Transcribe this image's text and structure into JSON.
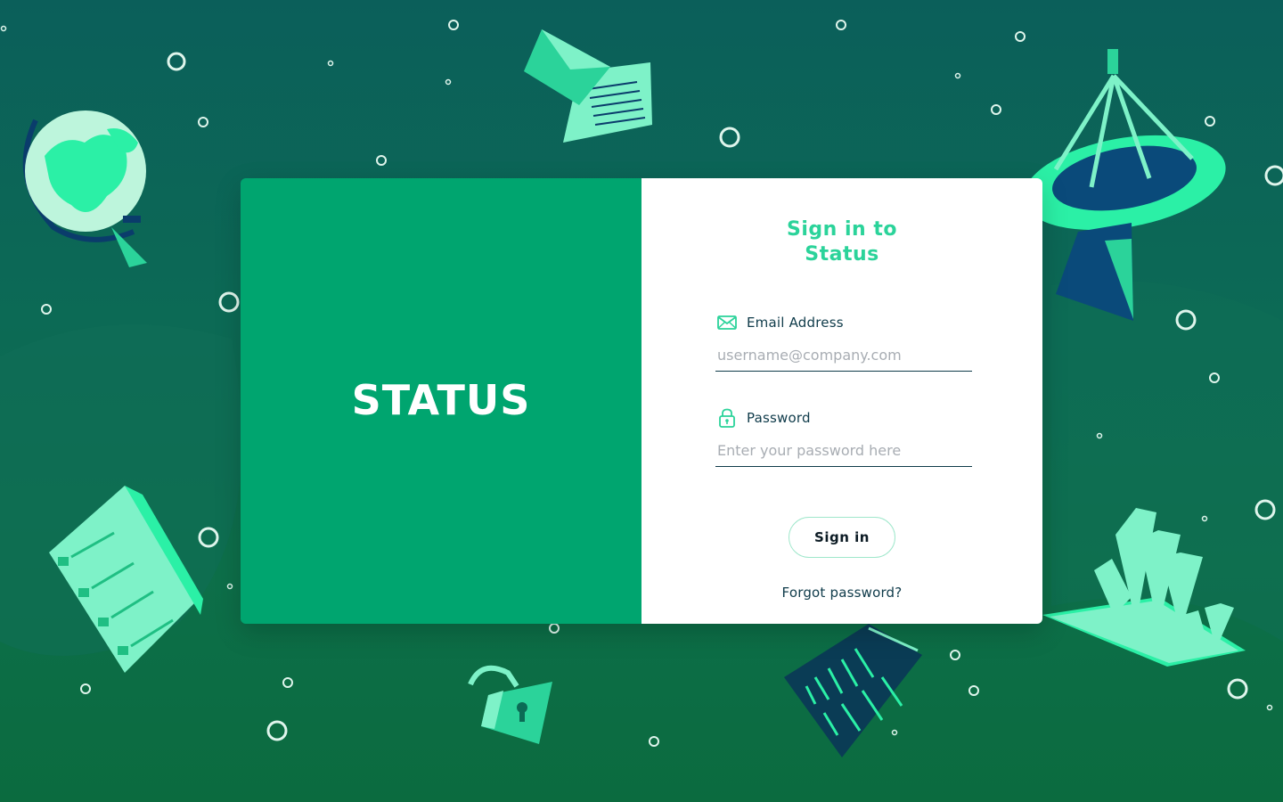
{
  "brand": {
    "logo_text": "STATUS",
    "panel_color": "#00a56f"
  },
  "form": {
    "title_line1": "Sign in to",
    "title_line2": "Status",
    "title_color": "#2bd39a",
    "email": {
      "icon": "envelope-icon",
      "label": "Email Address",
      "value": "",
      "placeholder": "username@company.com"
    },
    "password": {
      "icon": "padlock-icon",
      "label": "Password",
      "value": "",
      "placeholder": "Enter your password here"
    },
    "signin_label": "Sign in",
    "forgot_label": "Forgot password?"
  },
  "background": {
    "illustrations": [
      "globe-illustration",
      "envelope-document-illustration",
      "satellite-dish-illustration",
      "server-rack-illustration",
      "padlock-illustration",
      "code-screen-illustration",
      "bar-chart-illustration"
    ],
    "colors": [
      "#0b5f5a",
      "#0d6f4a",
      "#2bf0a6",
      "#7ef2c8",
      "#0a3c6b"
    ]
  }
}
